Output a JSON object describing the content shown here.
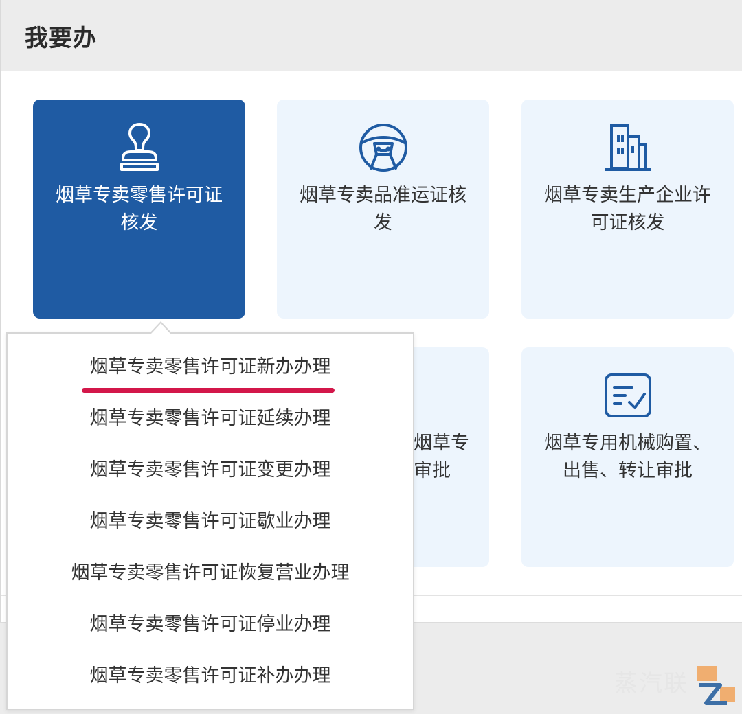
{
  "header": {
    "title": "我要办"
  },
  "tiles": [
    {
      "label": "烟草专卖零售许可证核发",
      "icon": "stamp-icon",
      "active": true
    },
    {
      "label": "烟草专卖品准运证核发",
      "icon": "steering-wheel-icon",
      "active": false
    },
    {
      "label": "烟草专卖生产企业许可证核发",
      "icon": "building-icon",
      "active": false
    },
    {
      "label_partial_line1": "烟草专",
      "label_partial_line2": "审批",
      "active": false
    },
    {
      "label": "烟草专用机械购置、出售、转让审批",
      "icon": "checklist-icon",
      "active": false
    }
  ],
  "dropdown": {
    "items": [
      {
        "label": "烟草专卖零售许可证新办办理",
        "selected": true
      },
      {
        "label": "烟草专卖零售许可证延续办理"
      },
      {
        "label": "烟草专卖零售许可证变更办理"
      },
      {
        "label": "烟草专卖零售许可证歇业办理"
      },
      {
        "label": "烟草专卖零售许可证恢复营业办理"
      },
      {
        "label": "烟草专卖零售许可证停业办理"
      },
      {
        "label": "烟草专卖零售许可证补办办理"
      }
    ]
  },
  "watermark": {
    "text": "蒸汽联"
  },
  "colors": {
    "active_tile": "#1f5ba3",
    "tile_bg": "#edf5fd",
    "icon_blue": "#1f5ba3",
    "underline": "#d3174a"
  }
}
